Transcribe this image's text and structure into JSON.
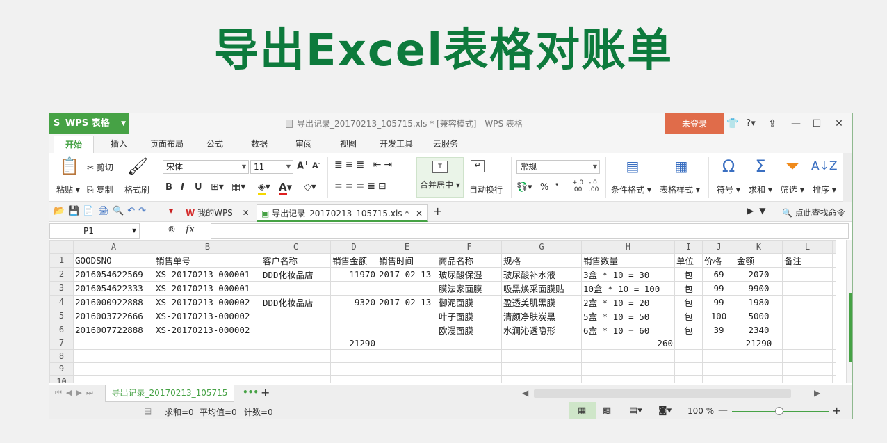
{
  "banner": "导出Excel表格对账单",
  "app": {
    "name": "WPS 表格",
    "window_title": "导出记录_20170213_105715.xls * [兼容模式] - WPS 表格",
    "login": "未登录",
    "help": "?"
  },
  "tabs": [
    "开始",
    "插入",
    "页面布局",
    "公式",
    "数据",
    "审阅",
    "视图",
    "开发工具",
    "云服务"
  ],
  "ribbon": {
    "paste": "粘贴",
    "cut": "剪切",
    "copy": "复制",
    "format_painter": "格式刷",
    "font_name": "宋体",
    "font_size": "11",
    "bold": "B",
    "italic": "I",
    "underline": "U",
    "merge_center": "合并居中",
    "wrap_text": "自动换行",
    "number_format": "常规",
    "percent": "%",
    "conditional_format": "条件格式",
    "table_style": "表格样式",
    "symbol": "符号",
    "sum": "求和",
    "filter": "筛选",
    "sort": "排序"
  },
  "doc_tabs": {
    "home": "我的WPS",
    "file": "导出记录_20170213_105715.xls *",
    "search": "点此查找命令"
  },
  "formula_bar": {
    "cell_ref": "P1",
    "fx": "fx"
  },
  "sheet": {
    "columns": [
      "A",
      "B",
      "C",
      "D",
      "E",
      "F",
      "G",
      "H",
      "I",
      "J",
      "K",
      "L"
    ],
    "rows": [
      [
        "GOODSNO",
        "销售单号",
        "客户名称",
        "销售金额",
        "销售时间",
        "商品名称",
        "规格",
        "销售数量",
        "单位",
        "价格",
        "金额",
        "备注"
      ],
      [
        "2016054622569",
        "XS-20170213-000001",
        "DDD化妆品店",
        "11970",
        "2017-02-13",
        "玻尿酸保湿",
        "玻尿酸补水液",
        "3盒 * 10 = 30",
        "包",
        "69",
        "2070",
        ""
      ],
      [
        "2016054622333",
        "XS-20170213-000001",
        "",
        "",
        "",
        "膜法家面膜",
        "吸黑焕采面膜贴",
        "10盒 * 10 = 100",
        "包",
        "99",
        "9900",
        ""
      ],
      [
        "2016000922888",
        "XS-20170213-000002",
        "DDD化妆品店",
        "9320",
        "2017-02-13",
        "御泥面膜",
        "盈透美肌黑膜",
        "2盒 * 10 = 20",
        "包",
        "99",
        "1980",
        ""
      ],
      [
        "2016003722666",
        "XS-20170213-000002",
        "",
        "",
        "",
        "叶子面膜",
        "清颜净肤炭黑",
        "5盒 * 10 = 50",
        "包",
        "100",
        "5000",
        ""
      ],
      [
        "2016007722888",
        "XS-20170213-000002",
        "",
        "",
        "",
        "欧漫面膜",
        "水润沁透隐形",
        "6盒 * 10 = 60",
        "包",
        "39",
        "2340",
        ""
      ],
      [
        "",
        "",
        "",
        "21290",
        "",
        "",
        "",
        "260",
        "",
        "",
        "21290",
        ""
      ],
      [
        "",
        "",
        "",
        "",
        "",
        "",
        "",
        "",
        "",
        "",
        "",
        ""
      ],
      [
        "",
        "",
        "",
        "",
        "",
        "",
        "",
        "",
        "",
        "",
        "",
        ""
      ],
      [
        "",
        "",
        "",
        "",
        "",
        "",
        "",
        "",
        "",
        "",
        "",
        ""
      ]
    ]
  },
  "sheet_tab": "导出记录_20170213_105715",
  "status": {
    "sum": "求和=0",
    "average": "平均值=0",
    "count": "计数=0",
    "zoom": "100 %"
  }
}
